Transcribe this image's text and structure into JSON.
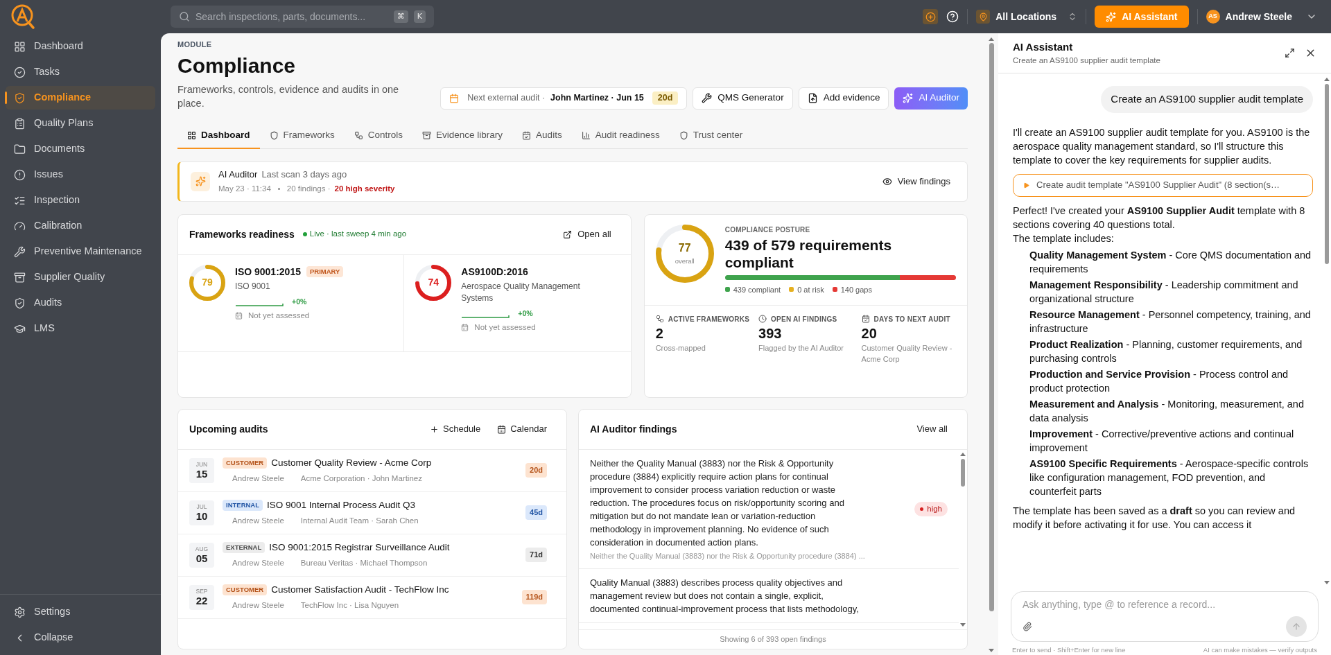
{
  "topbar": {
    "search": {
      "placeholder": "Search inspections, parts, documents...",
      "keys": [
        "⌘",
        "K"
      ]
    },
    "location": "All Locations",
    "assistant_button": "AI Assistant",
    "user": {
      "initials": "AS",
      "name": "Andrew Steele"
    }
  },
  "sidebar": {
    "items": [
      {
        "label": "Dashboard",
        "selected": false
      },
      {
        "label": "Tasks",
        "selected": false
      },
      {
        "label": "Compliance",
        "selected": true
      },
      {
        "label": "Quality Plans",
        "selected": false
      },
      {
        "label": "Documents",
        "selected": false
      },
      {
        "label": "Issues",
        "selected": false
      },
      {
        "label": "Inspection",
        "selected": false
      },
      {
        "label": "Calibration",
        "selected": false
      },
      {
        "label": "Preventive Maintenance",
        "selected": false
      },
      {
        "label": "Supplier Quality",
        "selected": false
      },
      {
        "label": "Audits",
        "selected": false
      },
      {
        "label": "LMS",
        "selected": false
      }
    ],
    "footer": [
      "Settings",
      "Collapse"
    ]
  },
  "page": {
    "eyebrow": "MODULE",
    "title": "Compliance",
    "description": "Frameworks, controls, evidence and audits in one place.",
    "next_audit": {
      "label": "Next external audit ·",
      "value": "John Martinez · Jun 15",
      "badge": "20d"
    },
    "actions": [
      {
        "label": "QMS Generator",
        "kind": "secondary"
      },
      {
        "label": "Add evidence",
        "kind": "secondary"
      },
      {
        "label": "AI Auditor",
        "kind": "primary"
      }
    ],
    "tabs": [
      {
        "label": "Dashboard",
        "selected": true
      },
      {
        "label": "Frameworks",
        "selected": false
      },
      {
        "label": "Controls",
        "selected": false
      },
      {
        "label": "Evidence library",
        "selected": false
      },
      {
        "label": "Audits",
        "selected": false
      },
      {
        "label": "Audit readiness",
        "selected": false
      },
      {
        "label": "Trust center",
        "selected": false
      }
    ]
  },
  "ai_scan": {
    "title": "AI Auditor",
    "subtitle": "Last scan 3 days ago",
    "date": "May 23 · 11:34",
    "findings": "20 findings ·",
    "severity": "20 high severity",
    "action": "View findings"
  },
  "frameworks": {
    "title": "Frameworks readiness",
    "live": "Live · last sweep 4 min ago",
    "action": "Open all",
    "items": [
      {
        "name": "ISO 9001:2015",
        "badge": "PRIMARY",
        "description": "ISO 9001",
        "score": "79",
        "level": 0.79,
        "color": "#d9a312",
        "trend": "+0%",
        "status": "Not yet assessed"
      },
      {
        "name": "AS9100D:2016",
        "description": "Aerospace Quality Management Systems",
        "score": "74",
        "level": 0.74,
        "color": "#dc1f1f",
        "trend": "+0%",
        "status": "Not yet assessed"
      }
    ]
  },
  "posture": {
    "eyebrow": "COMPLIANCE POSTURE",
    "score": "77",
    "score_label": "overall",
    "level": 0.77,
    "headline": "439 of 579 requirements compliant",
    "segments": [
      {
        "label": "439 compliant",
        "level": 0.758,
        "color": "#3fa34d"
      },
      {
        "label": "0 at risk",
        "level": 0,
        "color": "#e6b020"
      },
      {
        "label": "140 gaps",
        "level": 0.242,
        "color": "#e53935"
      }
    ],
    "stats": [
      {
        "label": "ACTIVE FRAMEWORKS",
        "value": "2",
        "note": "Cross-mapped"
      },
      {
        "label": "OPEN AI FINDINGS",
        "value": "393",
        "note": "Flagged by the AI Auditor"
      },
      {
        "label": "DAYS TO NEXT AUDIT",
        "value": "20",
        "note": "Customer Quality Review - Acme Corp"
      }
    ]
  },
  "upcoming": {
    "title": "Upcoming audits",
    "actions": [
      "Schedule",
      "Calendar"
    ],
    "rows": [
      {
        "month": "JUN",
        "day": "15",
        "kind": "customer",
        "tag": "CUSTOMER",
        "title": "Customer Quality Review - Acme Corp",
        "owner": "Andrew Steele",
        "party": "Acme Corporation · John Martinez",
        "due": "20d"
      },
      {
        "month": "JUL",
        "day": "10",
        "kind": "internal",
        "tag": "INTERNAL",
        "title": "ISO 9001 Internal Process Audit Q3",
        "owner": "Andrew Steele",
        "party": "Internal Audit Team · Sarah Chen",
        "due": "45d"
      },
      {
        "month": "AUG",
        "day": "05",
        "kind": "external",
        "tag": "EXTERNAL",
        "title": "ISO 9001:2015 Registrar Surveillance Audit",
        "owner": "Andrew Steele",
        "party": "Bureau Veritas · Michael Thompson",
        "due": "71d"
      },
      {
        "month": "SEP",
        "day": "22",
        "kind": "customer",
        "tag": "CUSTOMER",
        "title": "Customer Satisfaction Audit - TechFlow Inc",
        "owner": "Andrew Steele",
        "party": "TechFlow Inc · Lisa Nguyen",
        "due": "119d"
      }
    ]
  },
  "findings": {
    "title": "AI Auditor findings",
    "action": "View all",
    "footer": "Showing 6 of 393 open findings",
    "items": [
      {
        "text": "Neither the Quality Manual (3883) nor the Risk & Opportunity procedure (3884) explicitly require action plans for continual improvement to consider process variation reduction or waste reduction. The procedures focus on risk/opportunity scoring and mitigation but do not mandate lean or variation-reduction methodology in improvement planning. No evidence of such consideration in documented action plans.",
        "source": "Neither the Quality Manual (3883) nor the Risk & Opportunity procedure (3884) ...",
        "severity": "high"
      },
      {
        "text": "Quality Manual (3883) describes process quality objectives and management review but does not contain a single, explicit, documented continual-improvement process that lists methodology,"
      }
    ]
  },
  "assistant": {
    "title": "AI Assistant",
    "subtitle": "Create an AS9100 supplier audit template",
    "messages": [
      {
        "kind": "user",
        "text": "Create an AS9100 supplier audit template"
      },
      {
        "kind": "assistant",
        "paragraphs": [
          "I'll create an AS9100 supplier audit template for you. AS9100 is the aerospace quality management standard, so I'll structure this template to cover the key requirements for supplier audits."
        ]
      },
      {
        "kind": "tool",
        "text": "Create audit template \"AS9100 Supplier Audit\" (8 section(s…"
      },
      {
        "kind": "assistant",
        "paragraphs": [
          "Perfect! I've created your **AS9100 Supplier Audit** template with 8 sections covering 40 questions total.",
          "The template includes:"
        ],
        "list": [
          "**Quality Management System** - Core QMS documentation and requirements",
          "**Management Responsibility** - Leadership commitment and organizational structure",
          "**Resource Management** - Personnel competency, training, and infrastructure",
          "**Product Realization** - Planning, customer requirements, and purchasing controls",
          "**Production and Service Provision** - Process control and product protection",
          "**Measurement and Analysis** - Monitoring, measurement, and data analysis",
          "**Improvement** - Corrective/preventive actions and continual improvement",
          "**AS9100 Specific Requirements** - Aerospace-specific controls like configuration management, FOD prevention, and counterfeit parts"
        ],
        "closing": "The template has been saved as a **draft** so you can review and modify it before activating it for use. You can access it"
      }
    ],
    "input": {
      "placeholder": "Ask anything, type @ to reference a record..."
    },
    "hints": [
      "Enter to send · Shift+Enter for new line",
      "AI can make mistakes — verify outputs"
    ]
  }
}
